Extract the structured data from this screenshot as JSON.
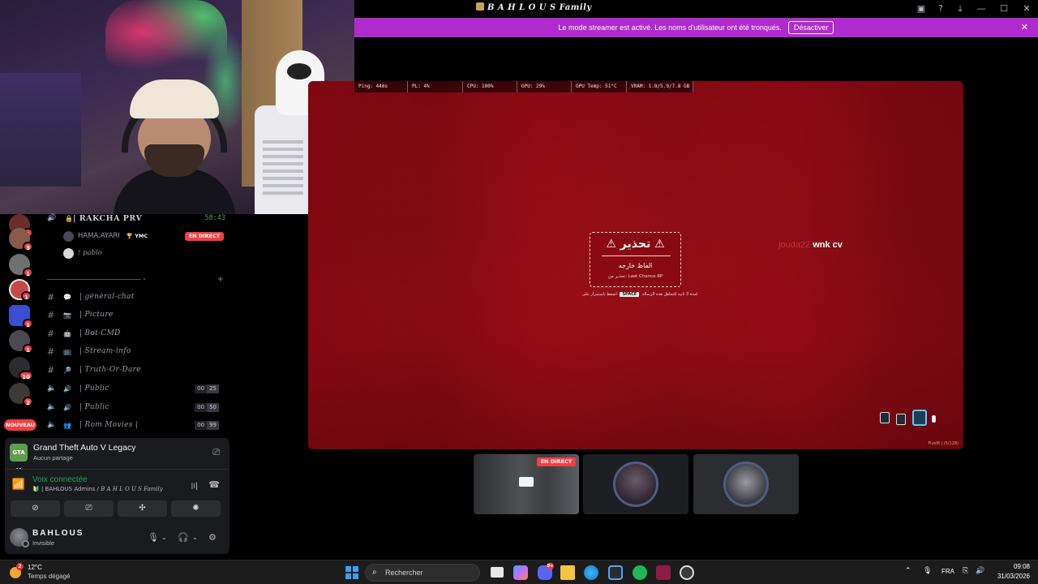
{
  "window": {
    "title": "B A H L O U S Family",
    "icons": [
      "screen-share-icon",
      "help-icon",
      "download-icon",
      "minimize-icon",
      "maximize-icon",
      "close-icon"
    ]
  },
  "banner": {
    "text": "Le mode streamer est activé. Les noms d'utilisateur ont été tronqués.",
    "button": "Désactiver",
    "bg_color": "#b02bcd"
  },
  "servers": [
    {
      "badge": "1"
    },
    {
      "badge": "3"
    },
    {
      "badge": "1"
    },
    {
      "badge": "1"
    },
    {
      "badge": "1"
    },
    {
      "badge": "1"
    },
    {
      "badge": "10"
    },
    {
      "badge": "2"
    }
  ],
  "server_new_label": "NOUVEAU",
  "voice_channel": {
    "name": "| RAKCHA PRV",
    "timer": "58:43",
    "members": [
      {
        "name": "HAMA.AYARI",
        "tag": "YMC",
        "live": "EN DIRECT"
      },
      {
        "name": "! pablo"
      }
    ]
  },
  "channels": [
    {
      "type": "text",
      "emoji": "💬",
      "name": "| gėnėral-chat"
    },
    {
      "type": "text",
      "emoji": "📷",
      "name": "| Picture"
    },
    {
      "type": "text",
      "emoji": "🤖",
      "name": "| Bot-CMD"
    },
    {
      "type": "text",
      "emoji": "📺",
      "name": "| Stream-info"
    },
    {
      "type": "text",
      "emoji": "🔎",
      "name": "| Truth-Or-Dare"
    },
    {
      "type": "voice",
      "emoji": "🔊",
      "name": "| Public",
      "count_a": "00",
      "count_b": "25"
    },
    {
      "type": "voice",
      "emoji": "🔊",
      "name": "| Public",
      "count_a": "00",
      "count_b": "50"
    },
    {
      "type": "voice",
      "emoji": "👥",
      "name": "| Rom Movies |",
      "count_a": "00",
      "count_b": "99"
    }
  ],
  "activity": {
    "game": "Grand Theft Auto V Legacy",
    "sub": "Aucun partage",
    "icon_label": "GTA V"
  },
  "voice": {
    "status": "Voix connectée",
    "server_prefix": "| BAHLOUS Admins /",
    "server_name": "B A H L O U S Family"
  },
  "user": {
    "name": "BAHLOUS",
    "status": "Invisible"
  },
  "stream": {
    "perf": [
      "Ping: 44ms",
      "PL: 4%",
      "CPU: 100%",
      "GPU: 29%",
      "GPU Temp: 51°C",
      "VRAM: 1.8/5.9/7.8 GB"
    ],
    "warning_title": "⚠ تحذير ⚠",
    "warning_reason": "الفاظ خارجه",
    "warning_by": "تحذير من: Last Chance RP",
    "warning_hint_pre": "اضغط باستمرار على",
    "warning_hint_key": "SPACE",
    "warning_hint_post": "لمدة 3 ثانية للتجاهل هذه الرسالة",
    "player_name": "jouda22",
    "player_text": "wnk cv",
    "hud_footer": "FiveM | (5/128)"
  },
  "thumbnails": {
    "live_label": "EN DIRECT"
  },
  "taskbar": {
    "temp": "12°C",
    "condition": "Temps dégagé",
    "weather_badge": "2",
    "search": "Rechercher",
    "discord_badge": "9+",
    "lang": "FRA",
    "time": "09:08",
    "date": "31/03/2026"
  }
}
